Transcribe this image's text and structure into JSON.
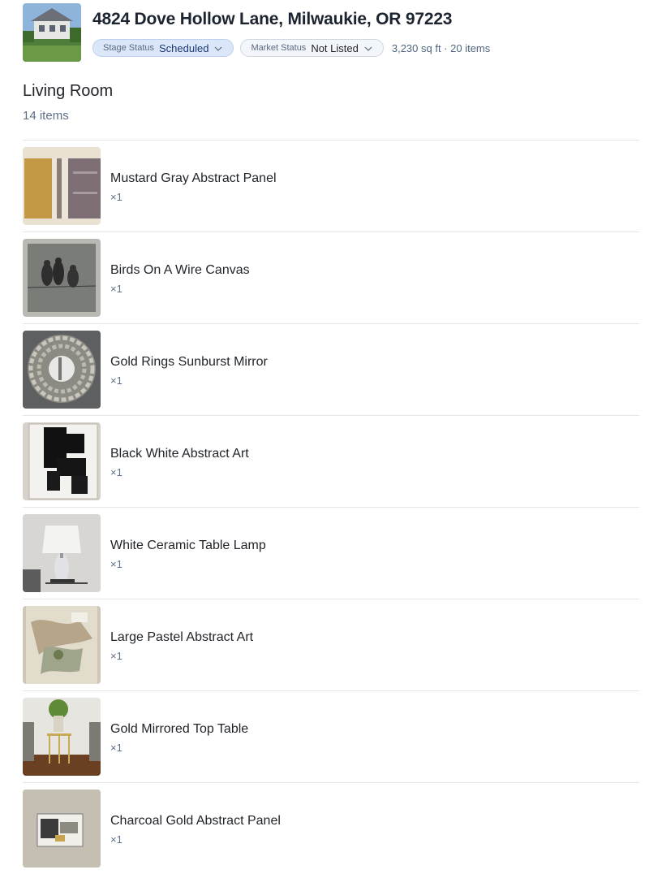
{
  "property": {
    "address": "4824 Dove Hollow Lane, Milwaukie, OR 97223",
    "stage_status": {
      "label": "Stage Status",
      "value": "Scheduled"
    },
    "market_status": {
      "label": "Market Status",
      "value": "Not Listed"
    },
    "summary": "3,230 sq ft · 20 items"
  },
  "section": {
    "title": "Living Room",
    "count": "14 items"
  },
  "items": [
    {
      "name": "Mustard Gray Abstract Panel",
      "qty": "×1",
      "icon": "abstract-panel-image"
    },
    {
      "name": "Birds On A Wire Canvas",
      "qty": "×1",
      "icon": "birds-canvas-image"
    },
    {
      "name": "Gold Rings Sunburst Mirror",
      "qty": "×1",
      "icon": "sunburst-mirror-image"
    },
    {
      "name": "Black White Abstract Art",
      "qty": "×1",
      "icon": "black-white-art-image"
    },
    {
      "name": "White Ceramic Table Lamp",
      "qty": "×1",
      "icon": "table-lamp-image"
    },
    {
      "name": "Large Pastel Abstract Art",
      "qty": "×1",
      "icon": "pastel-art-image"
    },
    {
      "name": "Gold Mirrored Top Table",
      "qty": "×1",
      "icon": "mirrored-table-image"
    },
    {
      "name": "Charcoal Gold Abstract Panel",
      "qty": "×1",
      "icon": "charcoal-panel-image"
    }
  ],
  "colors": {
    "stage_pill_bg": "#dbe7f8",
    "stage_value": "#1b3a73",
    "muted_text": "#5d6f86",
    "divider": "#e3e6ea"
  }
}
